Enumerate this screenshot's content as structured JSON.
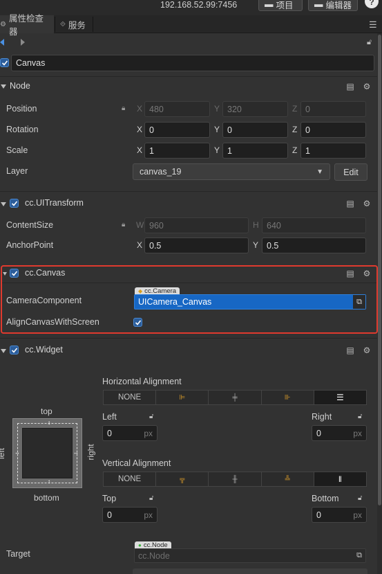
{
  "topbar": {
    "address": "192.168.52.99:7456",
    "project_label": "项目",
    "editor_label": "编辑器",
    "help_label": "?"
  },
  "tabs": [
    {
      "label": "属性检查器"
    },
    {
      "label": "服务"
    }
  ],
  "node_name": "Canvas",
  "node_section": {
    "title": "Node",
    "position": {
      "label": "Position",
      "x": "480",
      "y": "320",
      "z": "0"
    },
    "rotation": {
      "label": "Rotation",
      "x": "0",
      "y": "0",
      "z": "0"
    },
    "scale": {
      "label": "Scale",
      "x": "1",
      "y": "1",
      "z": "1"
    },
    "layer": {
      "label": "Layer",
      "value": "canvas_19",
      "edit_label": "Edit"
    }
  },
  "uitransform": {
    "title": "cc.UITransform",
    "content_size": {
      "label": "ContentSize",
      "w": "960",
      "h": "640"
    },
    "anchor_point": {
      "label": "AnchorPoint",
      "x": "0.5",
      "y": "0.5"
    }
  },
  "canvas_comp": {
    "title": "cc.Canvas",
    "camera_component": {
      "label": "CameraComponent",
      "type_tag": "cc.Camera",
      "value": "UICamera_Canvas"
    },
    "align_canvas": {
      "label": "AlignCanvasWithScreen",
      "checked": true
    }
  },
  "widget": {
    "title": "cc.Widget",
    "diagram": {
      "top": "top",
      "bottom": "bottom",
      "left": "left",
      "right": "right"
    },
    "horizontal_alignment": {
      "label": "Horizontal Alignment",
      "none_label": "NONE"
    },
    "left": {
      "label": "Left",
      "value": "0",
      "unit": "px"
    },
    "right": {
      "label": "Right",
      "value": "0",
      "unit": "px"
    },
    "vertical_alignment": {
      "label": "Vertical Alignment",
      "none_label": "NONE"
    },
    "top": {
      "label": "Top",
      "value": "0",
      "unit": "px"
    },
    "bottom": {
      "label": "Bottom",
      "value": "0",
      "unit": "px"
    },
    "target": {
      "label": "Target",
      "type_tag": "cc.Node",
      "placeholder": "cc.Node"
    }
  },
  "axes": {
    "x": "X",
    "y": "Y",
    "z": "Z",
    "w": "W",
    "h": "H"
  },
  "colors": {
    "accent": "#2b5d9b",
    "selection": "#1767c4",
    "highlight": "#e03a2e"
  }
}
